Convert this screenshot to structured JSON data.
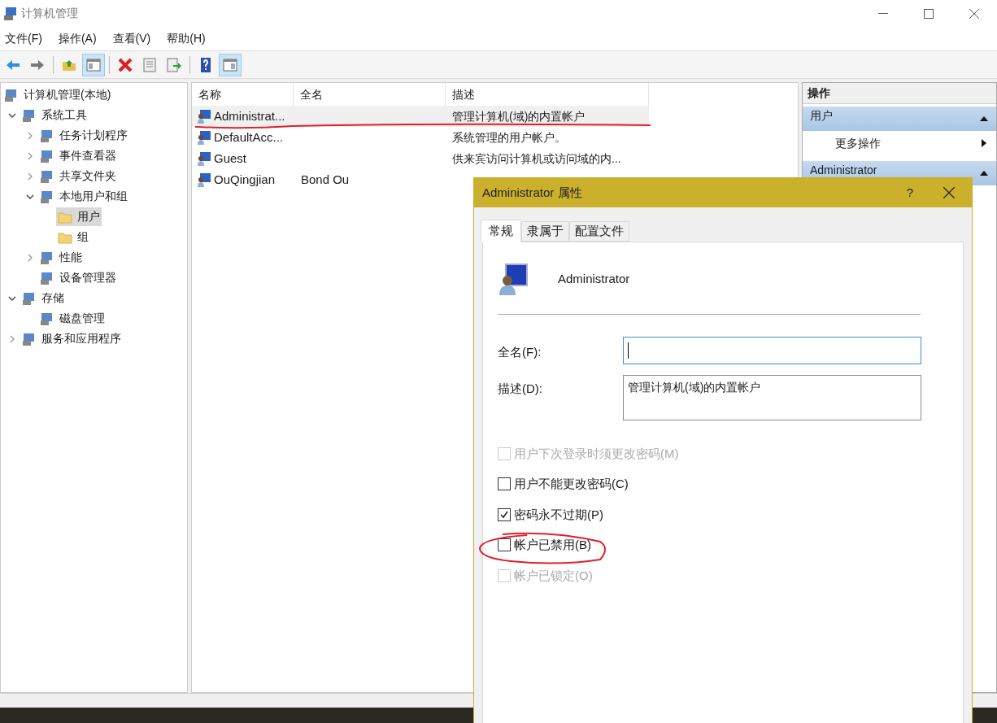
{
  "window": {
    "title": "计算机管理"
  },
  "menu": [
    "文件(F)",
    "操作(A)",
    "查看(V)",
    "帮助(H)"
  ],
  "toolbar": [
    {
      "pressed": false
    },
    {
      "pressed": false
    },
    {
      "pressed": false
    },
    {
      "pressed": true
    },
    {
      "pressed": false
    },
    {
      "pressed": false
    },
    {
      "pressed": false
    },
    {
      "pressed": false
    },
    {
      "pressed": true
    }
  ],
  "tree": [
    {
      "label": "计算机管理(本地)",
      "selected": false,
      "children": [
        {
          "label": "系统工具",
          "expanded": true,
          "selected": false,
          "children": [
            {
              "label": "任务计划程序",
              "expanded": false,
              "selected": false
            },
            {
              "label": "事件查看器",
              "expanded": false,
              "selected": false
            },
            {
              "label": "共享文件夹",
              "expanded": false,
              "selected": false
            },
            {
              "label": "本地用户和组",
              "expanded": true,
              "selected": false,
              "children": [
                {
                  "label": "用户",
                  "selected": true
                },
                {
                  "label": "组",
                  "selected": false
                }
              ]
            },
            {
              "label": "性能",
              "expanded": false,
              "selected": false
            },
            {
              "label": "设备管理器",
              "selected": false
            }
          ]
        },
        {
          "label": "存储",
          "expanded": true,
          "selected": false,
          "children": [
            {
              "label": "磁盘管理",
              "selected": false
            }
          ]
        },
        {
          "label": "服务和应用程序",
          "expanded": false,
          "selected": false
        }
      ]
    }
  ],
  "table": {
    "columns": [
      "名称",
      "全名",
      "描述"
    ],
    "rows": [
      {
        "name": "Administrat...",
        "description": "管理计算机(域)的内置帐户",
        "selected": true
      },
      {
        "name": "DefaultAcc...",
        "description": "系统管理的用户帐户。",
        "selected": false
      },
      {
        "name": "Guest",
        "description": "供来宾访问计算机或访问域的内...",
        "selected": false
      },
      {
        "name": "OuQingjian",
        "full_name": "Bond Ou",
        "selected": false
      }
    ]
  },
  "actions": {
    "title": "操作",
    "sections": [
      {
        "title": "用户",
        "items": [
          "更多操作"
        ]
      },
      {
        "title": "Administrator"
      }
    ]
  },
  "dialog": {
    "title": "Administrator 属性",
    "help": "?",
    "tabs": [
      {
        "label": "常规",
        "selected": true
      },
      {
        "label": "隶属于",
        "selected": false
      },
      {
        "label": "配置文件",
        "selected": false
      }
    ],
    "user_name": "Administrator",
    "fields": [
      {
        "label": "全名(F):",
        "focused": true,
        "multiline": false
      },
      {
        "label": "描述(D):",
        "value": "管理计算机(域)的内置帐户",
        "focused": false,
        "multiline": true
      }
    ],
    "checkboxes": [
      {
        "label": "用户下次登录时须更改密码(M)",
        "checked": false,
        "disabled": true
      },
      {
        "label": "用户不能更改密码(C)",
        "checked": false,
        "disabled": false
      },
      {
        "label": "密码永不过期(P)",
        "checked": true,
        "disabled": false
      },
      {
        "label": "帐户已禁用(B)",
        "checked": false,
        "disabled": false
      },
      {
        "label": "帐户已锁定(O)",
        "checked": false,
        "disabled": true
      }
    ]
  }
}
